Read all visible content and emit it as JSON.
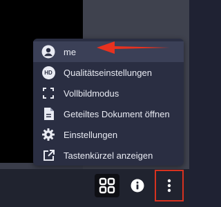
{
  "menu": {
    "items": [
      {
        "label": "me",
        "icon": "avatar-icon"
      },
      {
        "label": "Qualitätseinstellungen",
        "icon": "hd-icon",
        "badge": "HD"
      },
      {
        "label": "Vollbildmodus",
        "icon": "fullscreen-icon"
      },
      {
        "label": "Geteiltes Dokument öffnen",
        "icon": "document-icon"
      },
      {
        "label": "Einstellungen",
        "icon": "gear-icon"
      },
      {
        "label": "Tastenkürzel anzeigen",
        "icon": "external-link-icon"
      }
    ]
  },
  "toolbar": {
    "buttons": [
      "tile-view-icon",
      "info-icon",
      "more-vertical-icon"
    ]
  },
  "colors": {
    "menu_bg": "#2a2e42",
    "highlight_bg": "#3b4057",
    "annotation_red": "#e8321f",
    "text": "#e9ebf3"
  }
}
